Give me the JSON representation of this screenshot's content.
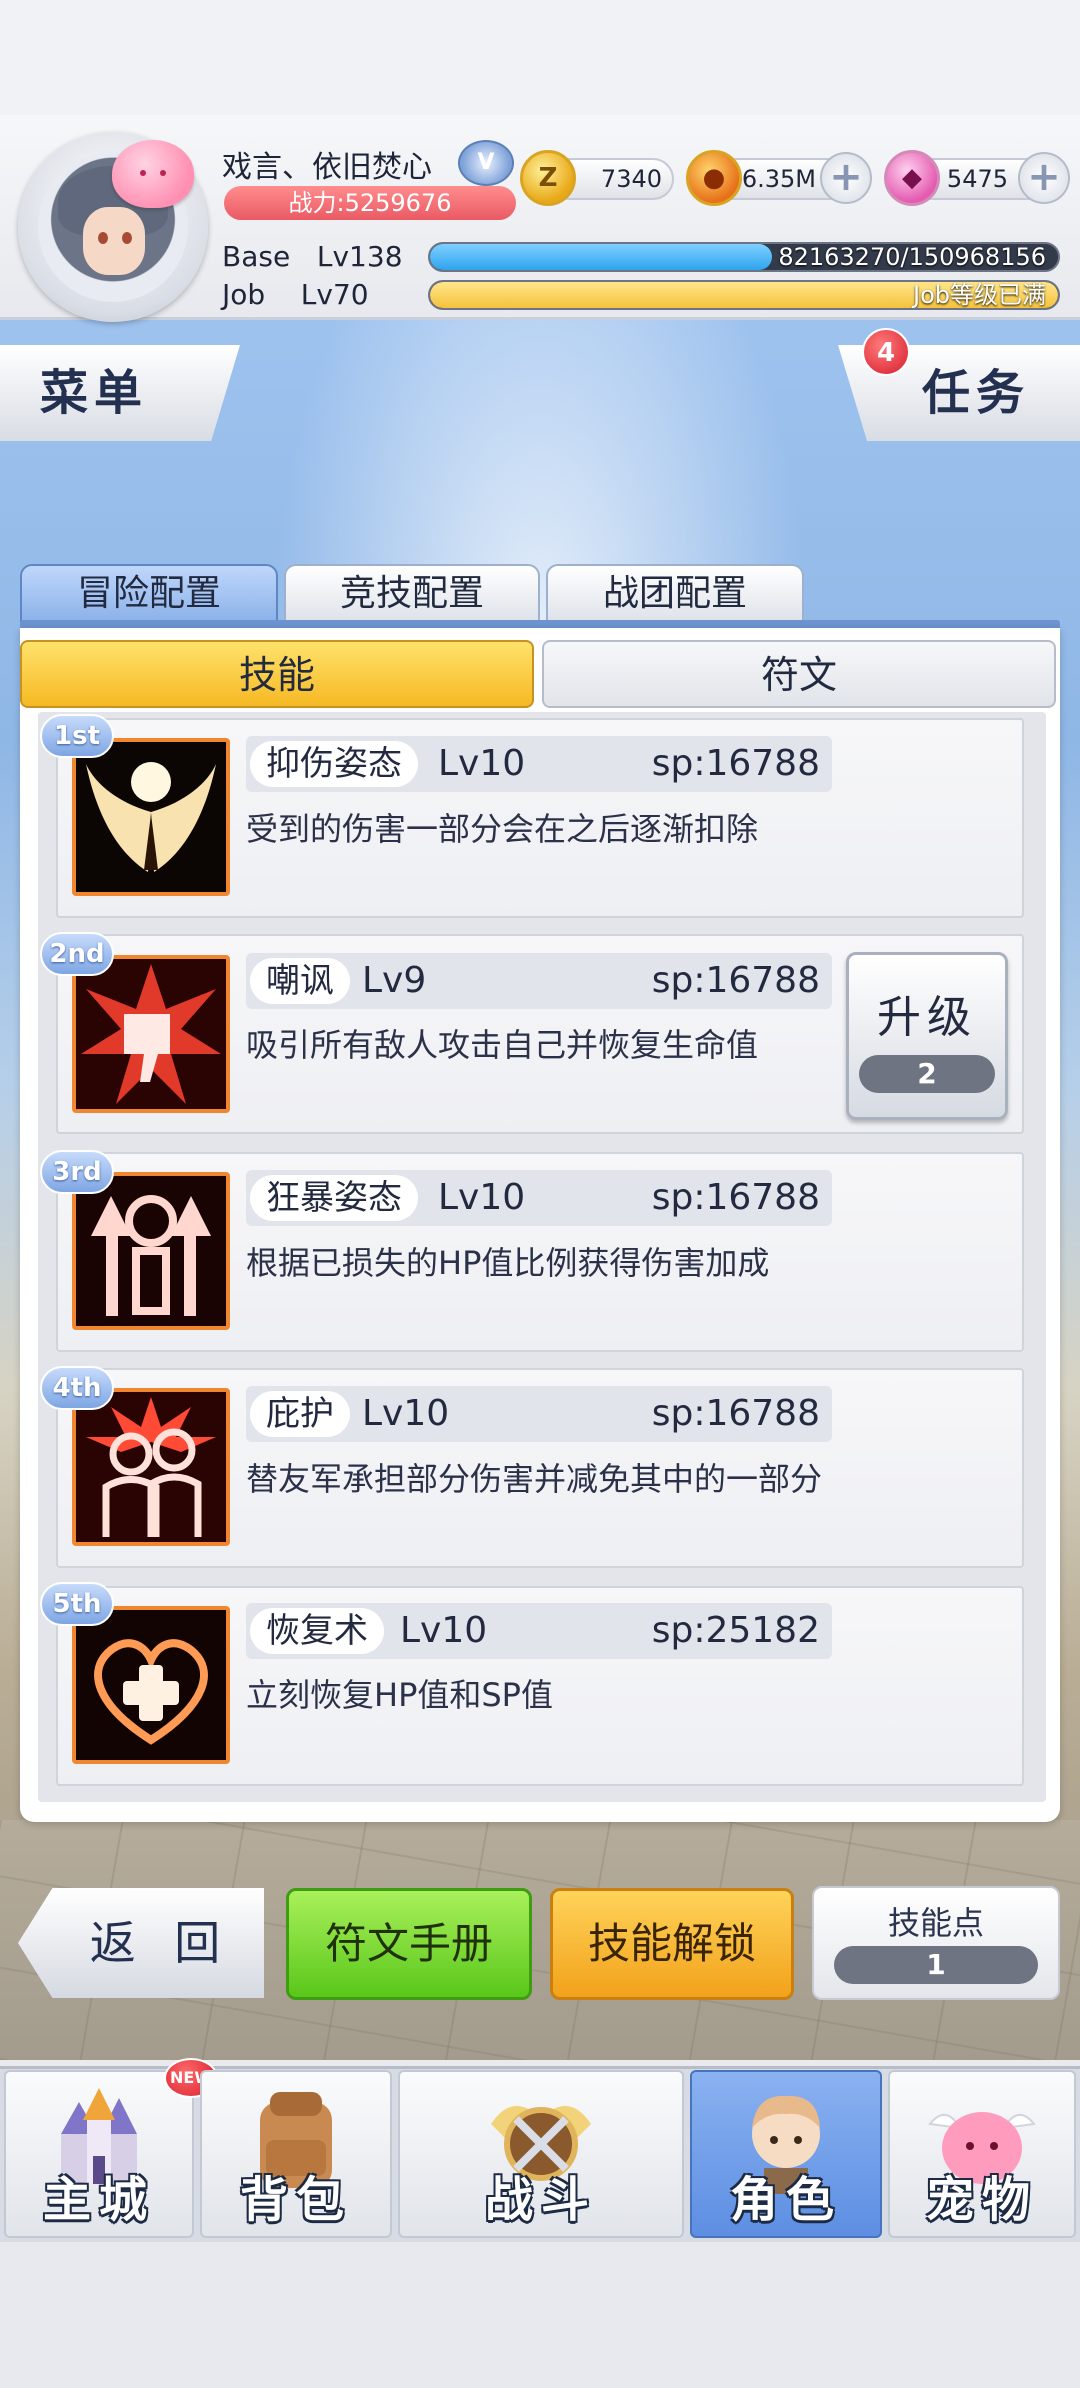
{
  "player": {
    "name": "戏言、依旧焚心",
    "combat_power": "战力:5259676",
    "base_label": "Base",
    "base_level": "Lv138",
    "base_exp_text": "82163270/150968156",
    "base_exp_progress": 0.544,
    "job_label": "Job",
    "job_level": "Lv70",
    "job_exp_text": "Job等级已满",
    "job_exp_progress": 1.0
  },
  "currencies": [
    {
      "name": "zeny",
      "icon": "zeny-coin-icon",
      "glyph": "Z",
      "value": "7340"
    },
    {
      "name": "gold",
      "icon": "gold-coin-icon",
      "glyph": "●",
      "value": "46.35M"
    },
    {
      "name": "gem",
      "icon": "gem-icon",
      "glyph": "◆",
      "value": "5475"
    }
  ],
  "buttons": {
    "menu": "菜单",
    "task": "任务",
    "task_badge": "4",
    "back": "返 回",
    "rune_manual": "符文手册",
    "skill_unlock": "技能解锁",
    "plus": "+"
  },
  "config_tabs": [
    "冒险配置",
    "竞技配置",
    "战团配置"
  ],
  "active_config_tab": 0,
  "sub_tabs": {
    "skill": "技能",
    "rune": "符文"
  },
  "skills": [
    {
      "rank": "1st",
      "name": "抑伤姿态",
      "level": "Lv10",
      "sp": "sp:16788",
      "desc": "受到的伤害一部分会在之后逐渐扣除",
      "icon": "wings-icon"
    },
    {
      "rank": "2nd",
      "name": "嘲讽",
      "level": "Lv9",
      "sp": "sp:16788",
      "desc": "吸引所有敌人攻击自己并恢复生命值",
      "icon": "thumbs-down-icon"
    },
    {
      "rank": "3rd",
      "name": "狂暴姿态",
      "level": "Lv10",
      "sp": "sp:16788",
      "desc": "根据已损失的HP值比例获得伤害加成",
      "icon": "rage-icon"
    },
    {
      "rank": "4th",
      "name": "庇护",
      "level": "Lv10",
      "sp": "sp:16788",
      "desc": "替友军承担部分伤害并减免其中的一部分",
      "icon": "protect-icon"
    },
    {
      "rank": "5th",
      "name": "恢复术",
      "level": "Lv10",
      "sp": "sp:25182",
      "desc": "立刻恢复HP值和SP值",
      "icon": "heal-heart-icon"
    }
  ],
  "upgrade": {
    "label": "升级",
    "cost": "2"
  },
  "skill_points": {
    "label": "技能点",
    "value": "1"
  },
  "nav": [
    {
      "label": "主城",
      "icon": "castle-icon",
      "badge": "NEW"
    },
    {
      "label": "背包",
      "icon": "backpack-icon"
    },
    {
      "label": "战斗",
      "icon": "battle-icon"
    },
    {
      "label": "角色",
      "icon": "character-icon"
    },
    {
      "label": "宠物",
      "icon": "pet-icon"
    }
  ],
  "active_nav": 3,
  "colors": {
    "base_exp": "#2fa4ee",
    "job_exp": "#f5c23c",
    "accent_blue": "#6d93d1",
    "skill_icon_border": "#f0872e"
  }
}
